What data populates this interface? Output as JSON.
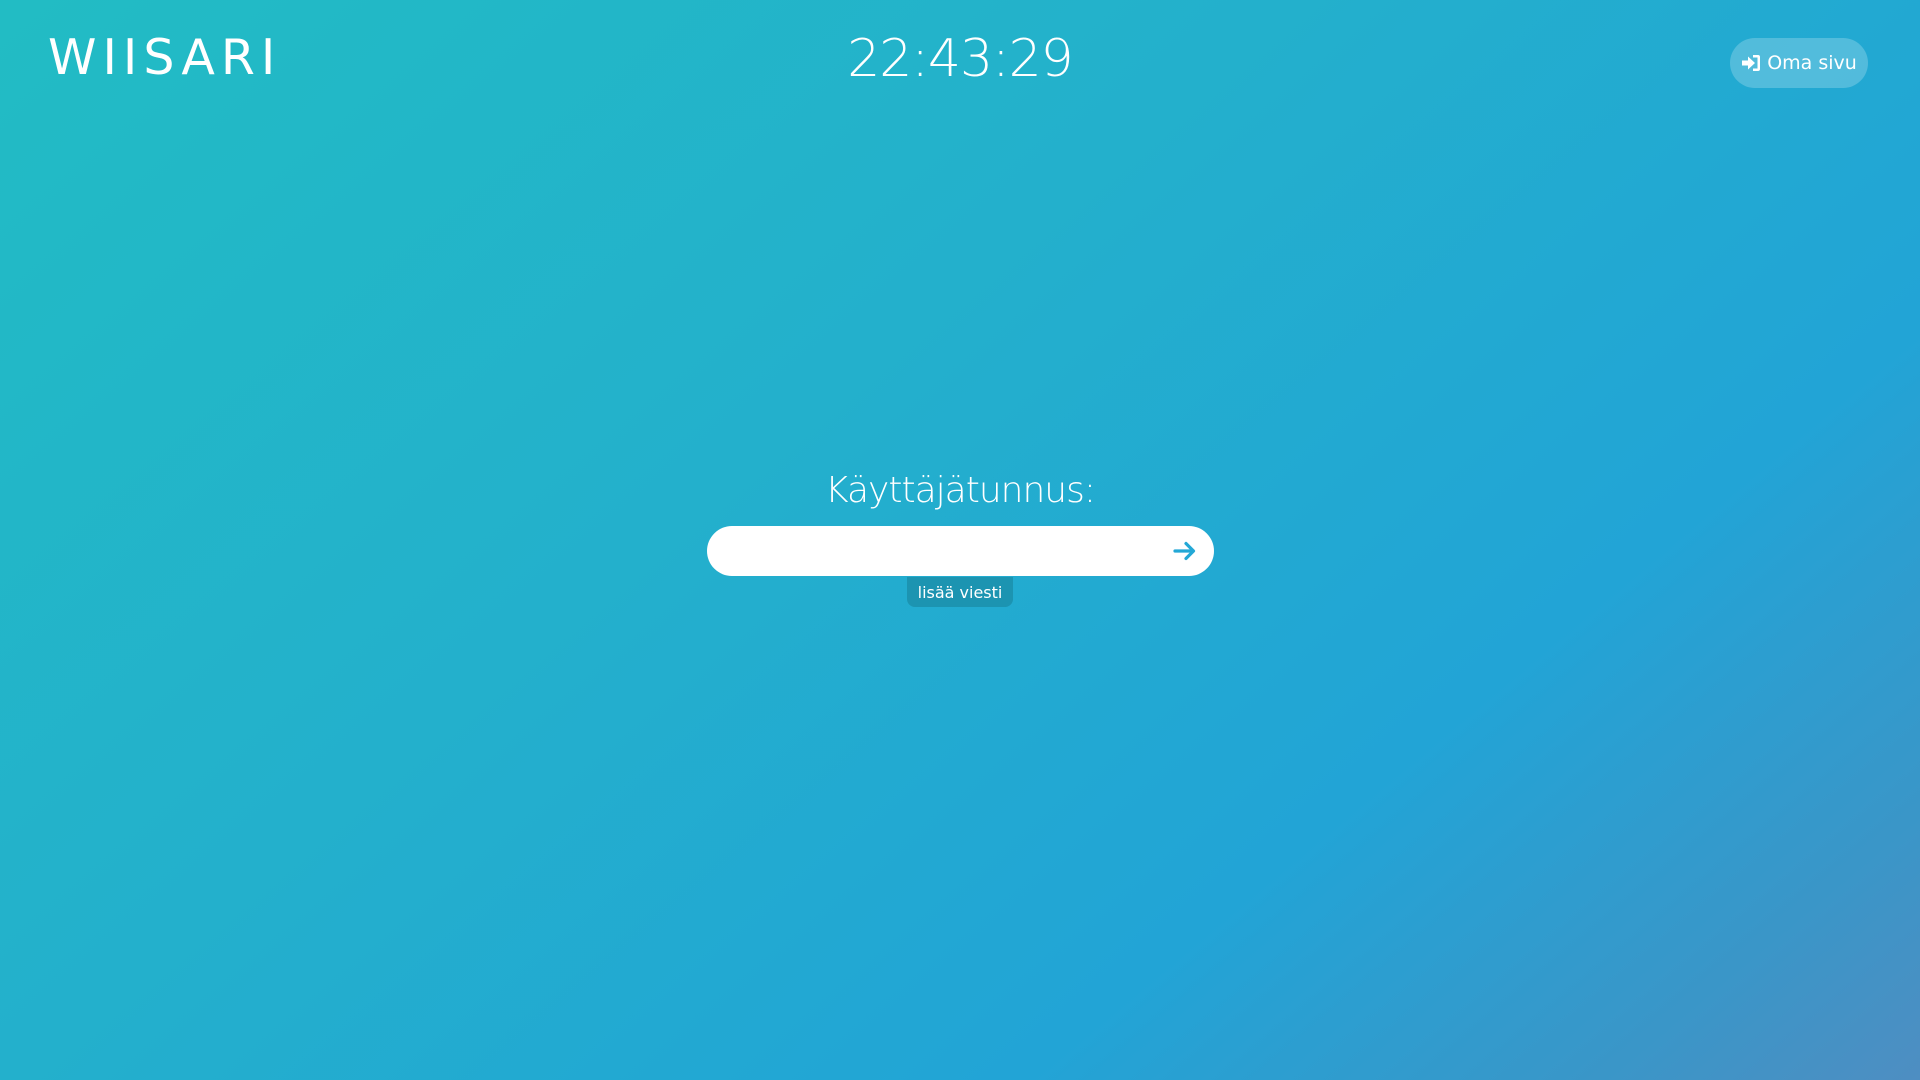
{
  "header": {
    "logo_text": "WIISARI",
    "clock": "22:43:29",
    "own_page_button": {
      "label": "Oma sivu",
      "icon": "sign-in-icon"
    }
  },
  "login": {
    "title": "Käyttäjätunnus:",
    "username_value": "",
    "submit_icon": "arrow-right-icon",
    "add_message_label": "lisää viesti"
  },
  "colors": {
    "background_start": "#22bcc4",
    "background_end": "#4e8ec2",
    "accent": "#22a4d6"
  }
}
